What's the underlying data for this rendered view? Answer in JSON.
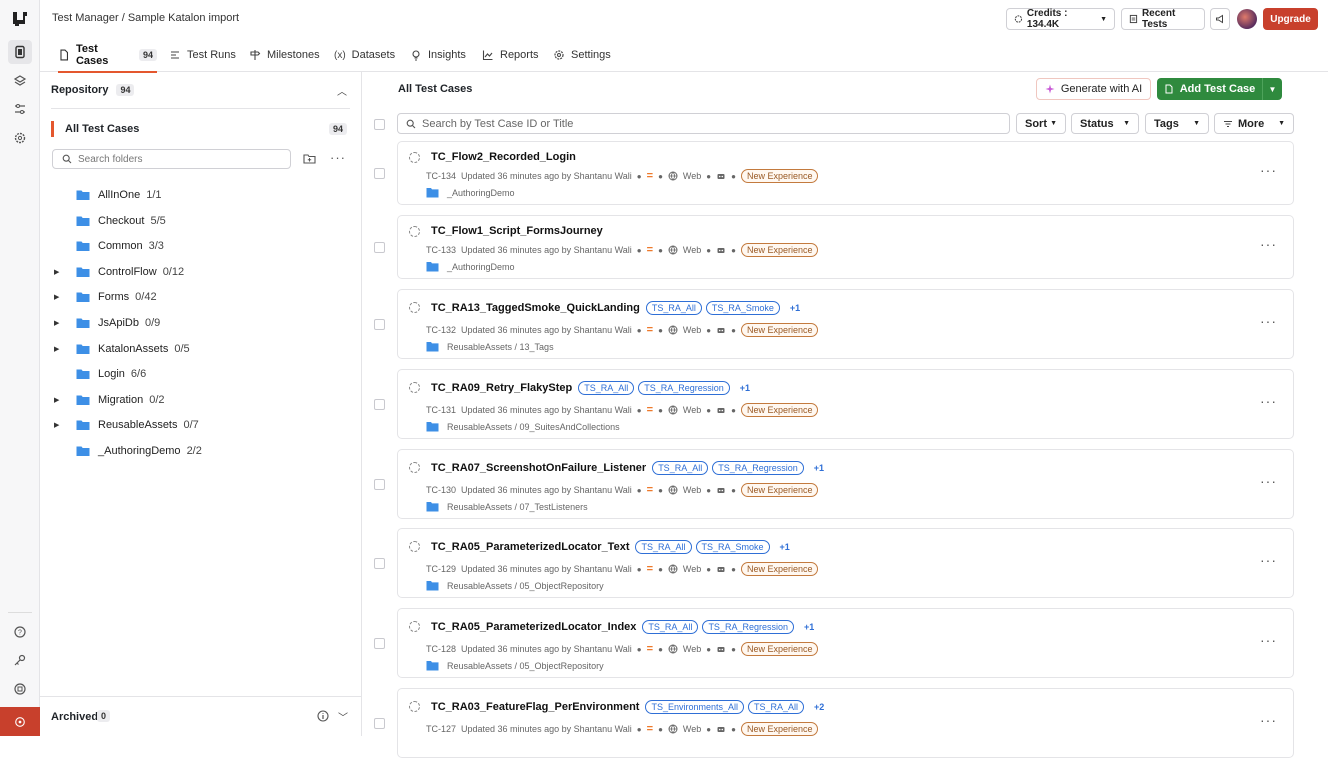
{
  "breadcrumb": "Test Manager / Sample Katalon import",
  "header": {
    "credits_label": "Credits : 134.4K",
    "recent_tests_label": "Recent Tests",
    "upgrade_label": "Upgrade"
  },
  "tabs": [
    {
      "label": "Test Cases",
      "count": "94"
    },
    {
      "label": "Test Runs"
    },
    {
      "label": "Milestones"
    },
    {
      "label": "Datasets"
    },
    {
      "label": "Insights"
    },
    {
      "label": "Reports"
    },
    {
      "label": "Settings"
    }
  ],
  "sidebar": {
    "repository_label": "Repository",
    "repository_count": "94",
    "all_cases_label": "All Test Cases",
    "all_cases_count": "94",
    "search_placeholder": "Search folders",
    "folders": [
      {
        "name": "AllInOne",
        "count": "1/1",
        "expandable": false
      },
      {
        "name": "Checkout",
        "count": "5/5",
        "expandable": false
      },
      {
        "name": "Common",
        "count": "3/3",
        "expandable": false
      },
      {
        "name": "ControlFlow",
        "count": "0/12",
        "expandable": true
      },
      {
        "name": "Forms",
        "count": "0/42",
        "expandable": true
      },
      {
        "name": "JsApiDb",
        "count": "0/9",
        "expandable": true
      },
      {
        "name": "KatalonAssets",
        "count": "0/5",
        "expandable": true
      },
      {
        "name": "Login",
        "count": "6/6",
        "expandable": false
      },
      {
        "name": "Migration",
        "count": "0/2",
        "expandable": true
      },
      {
        "name": "ReusableAssets",
        "count": "0/7",
        "expandable": true
      },
      {
        "name": "_AuthoringDemo",
        "count": "2/2",
        "expandable": false
      }
    ],
    "archived_label": "Archived",
    "archived_count": "0"
  },
  "main": {
    "title": "All Test Cases",
    "generate_ai_label": "Generate with AI",
    "add_test_case_label": "Add Test Case",
    "search_placeholder": "Search by Test Case ID or Title",
    "filters": {
      "sort": "Sort",
      "status": "Status",
      "tags": "Tags",
      "more": "More"
    },
    "cases": [
      {
        "title": "TC_Flow2_Recorded_Login",
        "tags": [],
        "more": "",
        "id": "TC-134",
        "updated": "Updated 36 minutes ago by Shantanu Wali",
        "platform": "Web",
        "badge": "New Experience",
        "path": "_AuthoringDemo"
      },
      {
        "title": "TC_Flow1_Script_FormsJourney",
        "tags": [],
        "more": "",
        "id": "TC-133",
        "updated": "Updated 36 minutes ago by Shantanu Wali",
        "platform": "Web",
        "badge": "New Experience",
        "path": "_AuthoringDemo"
      },
      {
        "title": "TC_RA13_TaggedSmoke_QuickLanding",
        "tags": [
          "TS_RA_All",
          "TS_RA_Smoke"
        ],
        "more": "+1",
        "id": "TC-132",
        "updated": "Updated 36 minutes ago by Shantanu Wali",
        "platform": "Web",
        "badge": "New Experience",
        "path": "ReusableAssets / 13_Tags"
      },
      {
        "title": "TC_RA09_Retry_FlakyStep",
        "tags": [
          "TS_RA_All",
          "TS_RA_Regression"
        ],
        "more": "+1",
        "id": "TC-131",
        "updated": "Updated 36 minutes ago by Shantanu Wali",
        "platform": "Web",
        "badge": "New Experience",
        "path": "ReusableAssets / 09_SuitesAndCollections"
      },
      {
        "title": "TC_RA07_ScreenshotOnFailure_Listener",
        "tags": [
          "TS_RA_All",
          "TS_RA_Regression"
        ],
        "more": "+1",
        "id": "TC-130",
        "updated": "Updated 36 minutes ago by Shantanu Wali",
        "platform": "Web",
        "badge": "New Experience",
        "path": "ReusableAssets / 07_TestListeners"
      },
      {
        "title": "TC_RA05_ParameterizedLocator_Text",
        "tags": [
          "TS_RA_All",
          "TS_RA_Smoke"
        ],
        "more": "+1",
        "id": "TC-129",
        "updated": "Updated 36 minutes ago by Shantanu Wali",
        "platform": "Web",
        "badge": "New Experience",
        "path": "ReusableAssets / 05_ObjectRepository"
      },
      {
        "title": "TC_RA05_ParameterizedLocator_Index",
        "tags": [
          "TS_RA_All",
          "TS_RA_Regression"
        ],
        "more": "+1",
        "id": "TC-128",
        "updated": "Updated 36 minutes ago by Shantanu Wali",
        "platform": "Web",
        "badge": "New Experience",
        "path": "ReusableAssets / 05_ObjectRepository"
      },
      {
        "title": "TC_RA03_FeatureFlag_PerEnvironment",
        "tags": [
          "TS_Environments_All",
          "TS_RA_All"
        ],
        "more": "+2",
        "id": "TC-127",
        "updated": "Updated 36 minutes ago by Shantanu Wali",
        "platform": "Web",
        "badge": "New Experience",
        "path": ""
      }
    ]
  }
}
